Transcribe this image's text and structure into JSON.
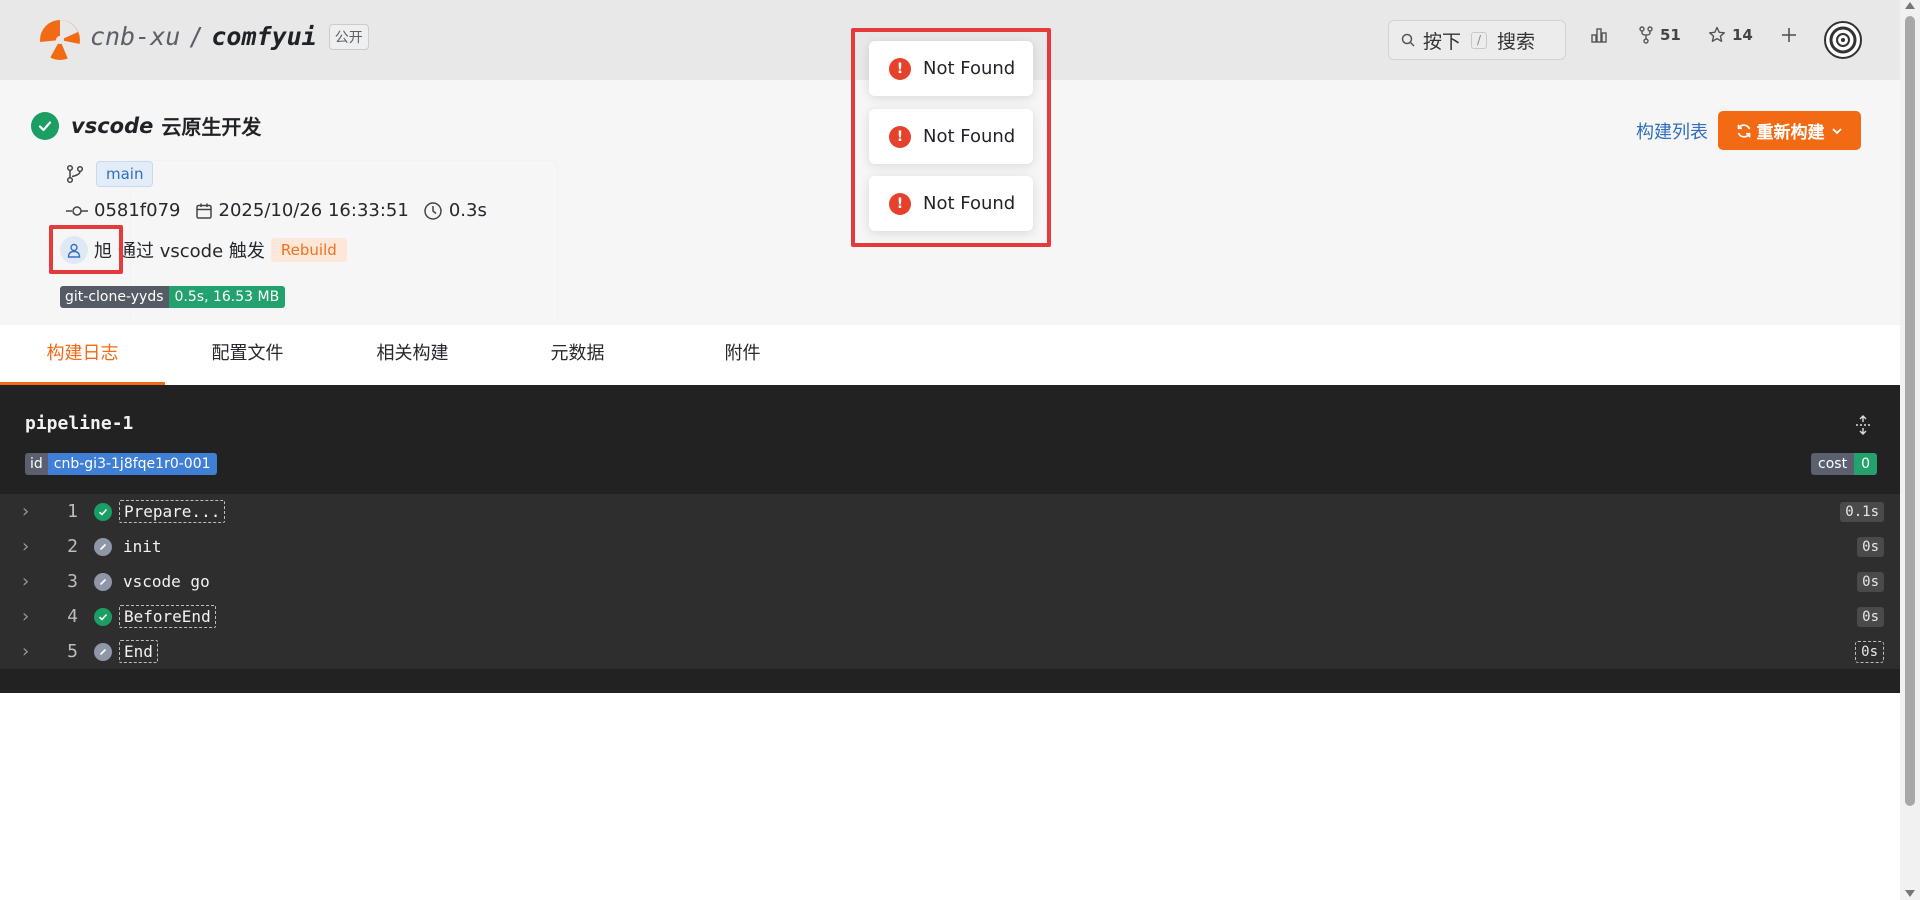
{
  "header": {
    "owner": "cnb-xu",
    "separator": "/",
    "repo": "comfyui",
    "visibility": "公开",
    "search": {
      "press_label": "按下",
      "key_hint": "/",
      "search_label": "搜索"
    },
    "stats": {
      "forks": "51",
      "stars": "14"
    }
  },
  "build": {
    "title_bold": "vscode",
    "title_rest": "云原生开发",
    "branch": "main",
    "commit": "0581f079",
    "datetime": "2025/10/26 16:33:51",
    "duration": "0.3s",
    "user": "旭",
    "trigger_text": "通过 vscode 触发",
    "trigger_tag": "Rebuild",
    "clone_name": "git-clone-yyds",
    "clone_stats": "0.5s, 16.53 MB",
    "build_list_link": "构建列表",
    "rebuild_button": "重新构建"
  },
  "tabs": [
    "构建日志",
    "配置文件",
    "相关构建",
    "元数据",
    "附件"
  ],
  "pipeline": {
    "name": "pipeline-1",
    "id_label": "id",
    "id_value": "cnb-gi3-1j8fqe1r0-001",
    "cost_label": "cost",
    "cost_value": "0",
    "steps": [
      {
        "num": "1",
        "name": "Prepare...",
        "status": "success",
        "duration": "0.1s"
      },
      {
        "num": "2",
        "name": "init",
        "status": "skipped",
        "duration": "0s"
      },
      {
        "num": "3",
        "name": "vscode go",
        "status": "skipped",
        "duration": "0s"
      },
      {
        "num": "4",
        "name": "BeforeEnd",
        "status": "success",
        "duration": "0s"
      },
      {
        "num": "5",
        "name": "End",
        "status": "skipped",
        "duration": "0s"
      }
    ]
  },
  "toasts": [
    "Not Found",
    "Not Found",
    "Not Found"
  ],
  "colors": {
    "accent": "#f26a13",
    "success": "#1a9e63",
    "error": "#e5412c",
    "highlight": "#e53a3a",
    "link": "#2f6fbd"
  },
  "icons": [
    "logo-icon",
    "search-icon",
    "chart-icon",
    "fork-icon",
    "star-icon",
    "plus-icon",
    "branch-icon",
    "commit-icon",
    "calendar-icon",
    "clock-icon",
    "user-icon",
    "refresh-icon",
    "chevron-down-icon",
    "expand-icon",
    "error-icon"
  ]
}
